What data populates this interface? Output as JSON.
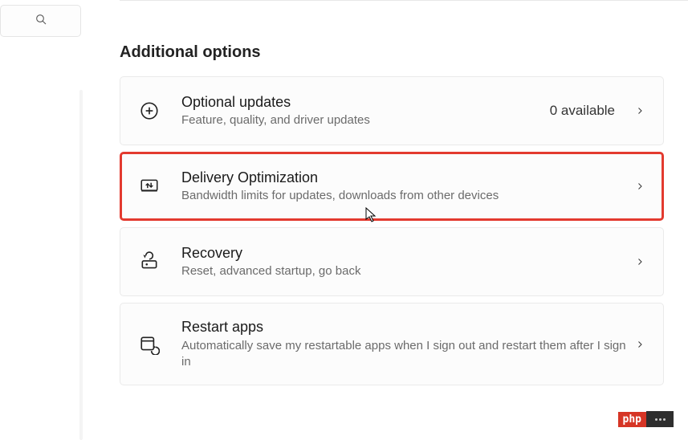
{
  "section_title": "Additional options",
  "items": [
    {
      "title": "Optional updates",
      "sub": "Feature, quality, and driver updates",
      "meta": "0 available"
    },
    {
      "title": "Delivery Optimization",
      "sub": "Bandwidth limits for updates, downloads from other devices"
    },
    {
      "title": "Recovery",
      "sub": "Reset, advanced startup, go back"
    },
    {
      "title": "Restart apps",
      "sub": "Automatically save my restartable apps when I sign out and restart them after I sign in"
    }
  ],
  "badge": "php"
}
